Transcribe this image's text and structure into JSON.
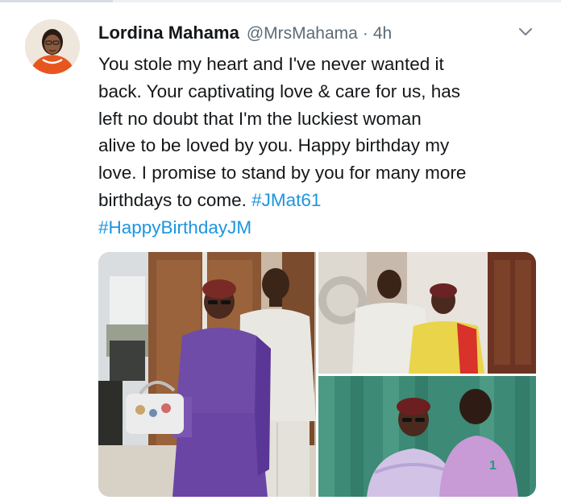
{
  "tweet": {
    "author_name": "Lordina Mahama",
    "author_handle": "@MrsMahama",
    "separator": "·",
    "timestamp": "4h",
    "text_lines": [
      "You stole my heart and I've never wanted it",
      "back. Your captivating love & care for us, has",
      "left no doubt that I'm the luckiest woman",
      "alive to be loved by you. Happy birthday my",
      "love. I promise to stand by you for many more",
      "birthdays to come. "
    ],
    "hashtags": [
      "#JMat61",
      "#HappyBirthdayJM"
    ],
    "photo_jersey_number": "1"
  },
  "colors": {
    "text": "#14171a",
    "muted": "#5c6b77",
    "link": "#1b95e0"
  },
  "icons": {
    "more_menu": "chevron-down-icon",
    "avatar": "profile-avatar"
  }
}
